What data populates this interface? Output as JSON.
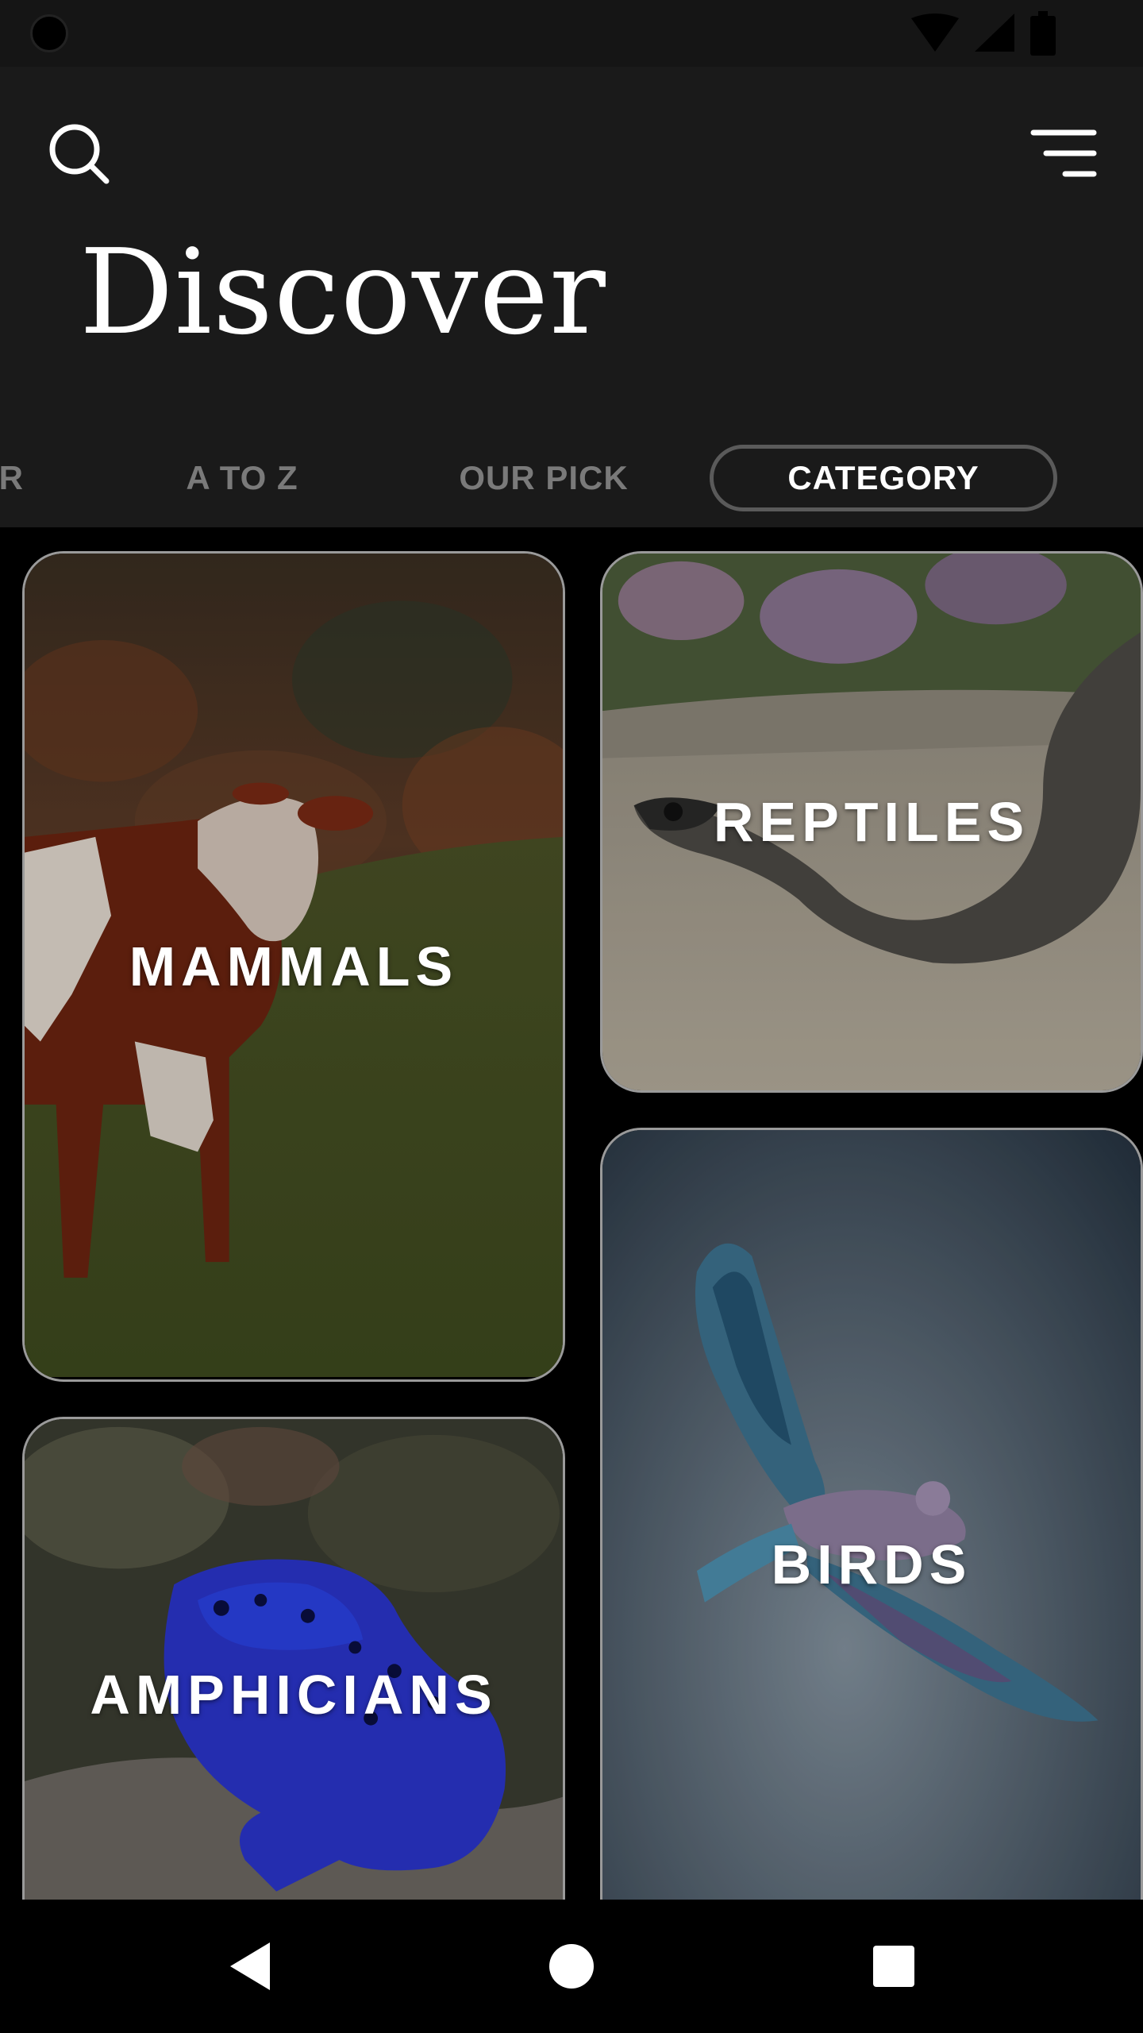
{
  "status_bar": {
    "icons": [
      "camera-cutout",
      "wifi-icon",
      "signal-icon",
      "battery-icon"
    ]
  },
  "header": {
    "title": "Discover",
    "search_icon": "search-icon",
    "menu_icon": "menu-icon"
  },
  "tabs": {
    "partial": "R",
    "items": [
      {
        "label": "A TO Z",
        "active": false
      },
      {
        "label": "OUR PICK",
        "active": false
      },
      {
        "label": "CATEGORY",
        "active": true
      }
    ]
  },
  "categories": [
    {
      "label": "MAMMALS"
    },
    {
      "label": "REPTILES"
    },
    {
      "label": "BIRDS"
    },
    {
      "label": "AMPHICIANS"
    }
  ],
  "nav_bar": {
    "back_icon": "back-icon",
    "home_icon": "home-icon",
    "recents_icon": "recents-icon"
  },
  "colors": {
    "header_bg": "#1a1a1a",
    "page_bg": "#000000",
    "active_tab_text": "#ffffff",
    "inactive_tab_text": "#7a7a7a"
  }
}
